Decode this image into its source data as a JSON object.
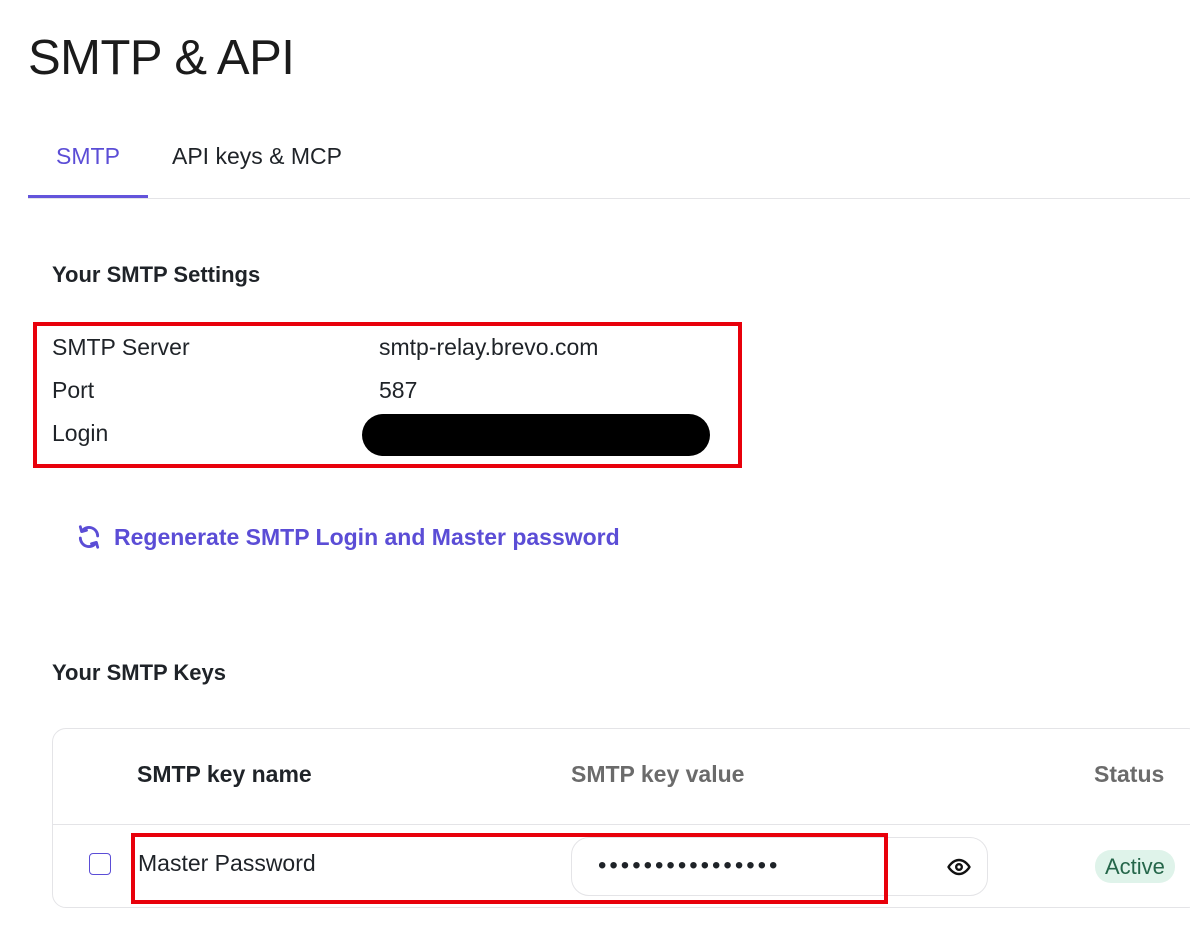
{
  "page": {
    "title": "SMTP & API"
  },
  "tabs": [
    {
      "label": "SMTP",
      "active": true
    },
    {
      "label": "API keys & MCP",
      "active": false
    }
  ],
  "settings": {
    "title": "Your SMTP Settings",
    "rows": [
      {
        "label": "SMTP Server",
        "value": "smtp-relay.brevo.com"
      },
      {
        "label": "Port",
        "value": "587"
      },
      {
        "label": "Login",
        "value": ""
      }
    ]
  },
  "regenerate": {
    "label": "Regenerate SMTP Login and Master password",
    "icon": "refresh-icon"
  },
  "keys": {
    "title": "Your SMTP Keys",
    "columns": {
      "name": "SMTP key name",
      "value": "SMTP key value",
      "status": "Status"
    },
    "rows": [
      {
        "name": "Master Password",
        "value": "••••••••••••••••",
        "status": "Active"
      }
    ]
  },
  "colors": {
    "accent": "#5b4dd6",
    "highlight": "#e8000b",
    "status_active_bg": "#dff3ea",
    "status_active_text": "#25664a"
  }
}
